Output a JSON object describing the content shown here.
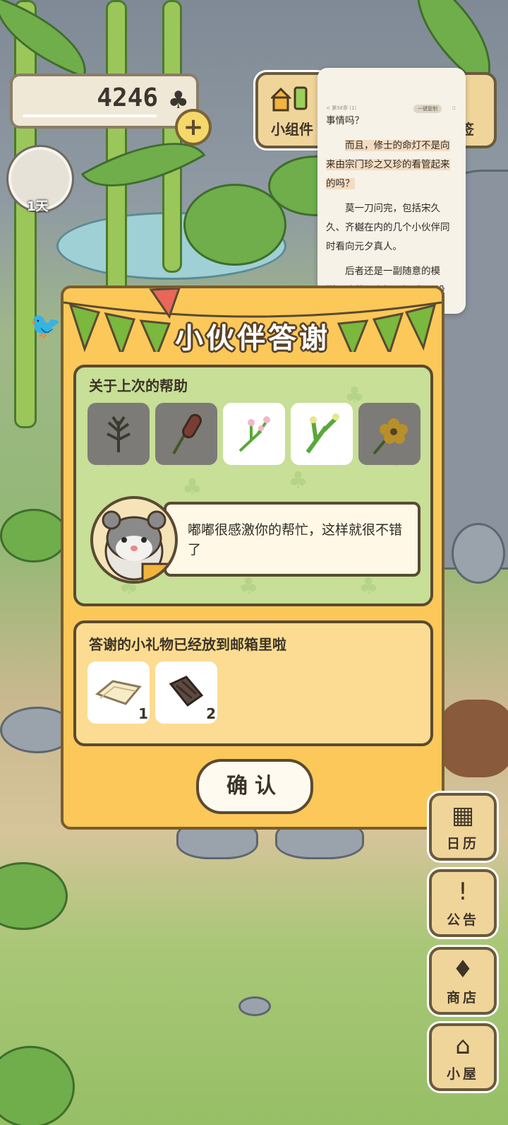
{
  "hud": {
    "clover_count": "4246",
    "clover_symbol": "♣",
    "add_label": "+",
    "day_label": "1天"
  },
  "widgets": {
    "widget_label": "小组件",
    "widget2_label": "签"
  },
  "reader": {
    "top_bar_text": "< 第58章 (1)",
    "pill_text": "一键复制",
    "close_text": "::",
    "paragraphs": [
      "事情吗？",
      "而且，修士的命灯不是向来由宗门珍之又珍的看管起来的吗？",
      "莫一刀问完，包括宋久久、齐樾在内的几个小伙伴同时看向元夕真人。",
      "后者还是一副随意的模样，冲着几人摆了摆手：“没"
    ]
  },
  "dialog": {
    "title": "小伙伴答谢",
    "help_heading": "关于上次的帮助",
    "help_items": [
      {
        "icon": "dry-herb-icon",
        "state": "dim"
      },
      {
        "icon": "cattail-icon",
        "state": "dim"
      },
      {
        "icon": "pink-flower-icon",
        "state": "lit"
      },
      {
        "icon": "green-plant-icon",
        "state": "lit"
      },
      {
        "icon": "yellow-flower-icon",
        "state": "dim"
      }
    ],
    "speech": "嘟嘟很感激你的帮忙，这样就很不错了",
    "gift_heading": "答谢的小礼物已经放到邮箱里啦",
    "gifts": [
      {
        "icon": "cloth-icon",
        "qty": "1"
      },
      {
        "icon": "bark-icon",
        "qty": "2"
      }
    ],
    "confirm": "确认"
  },
  "side_menu": [
    {
      "label": "日历",
      "icon": "calendar-icon"
    },
    {
      "label": "公告",
      "icon": "notice-icon"
    },
    {
      "label": "商店",
      "icon": "shop-icon"
    },
    {
      "label": "小屋",
      "icon": "house-icon"
    }
  ],
  "colors": {
    "dialog_bg": "#fbc859",
    "help_panel_bg": "#c7df97",
    "gift_panel_bg": "#fcdc92",
    "outline": "#5a4a32"
  }
}
